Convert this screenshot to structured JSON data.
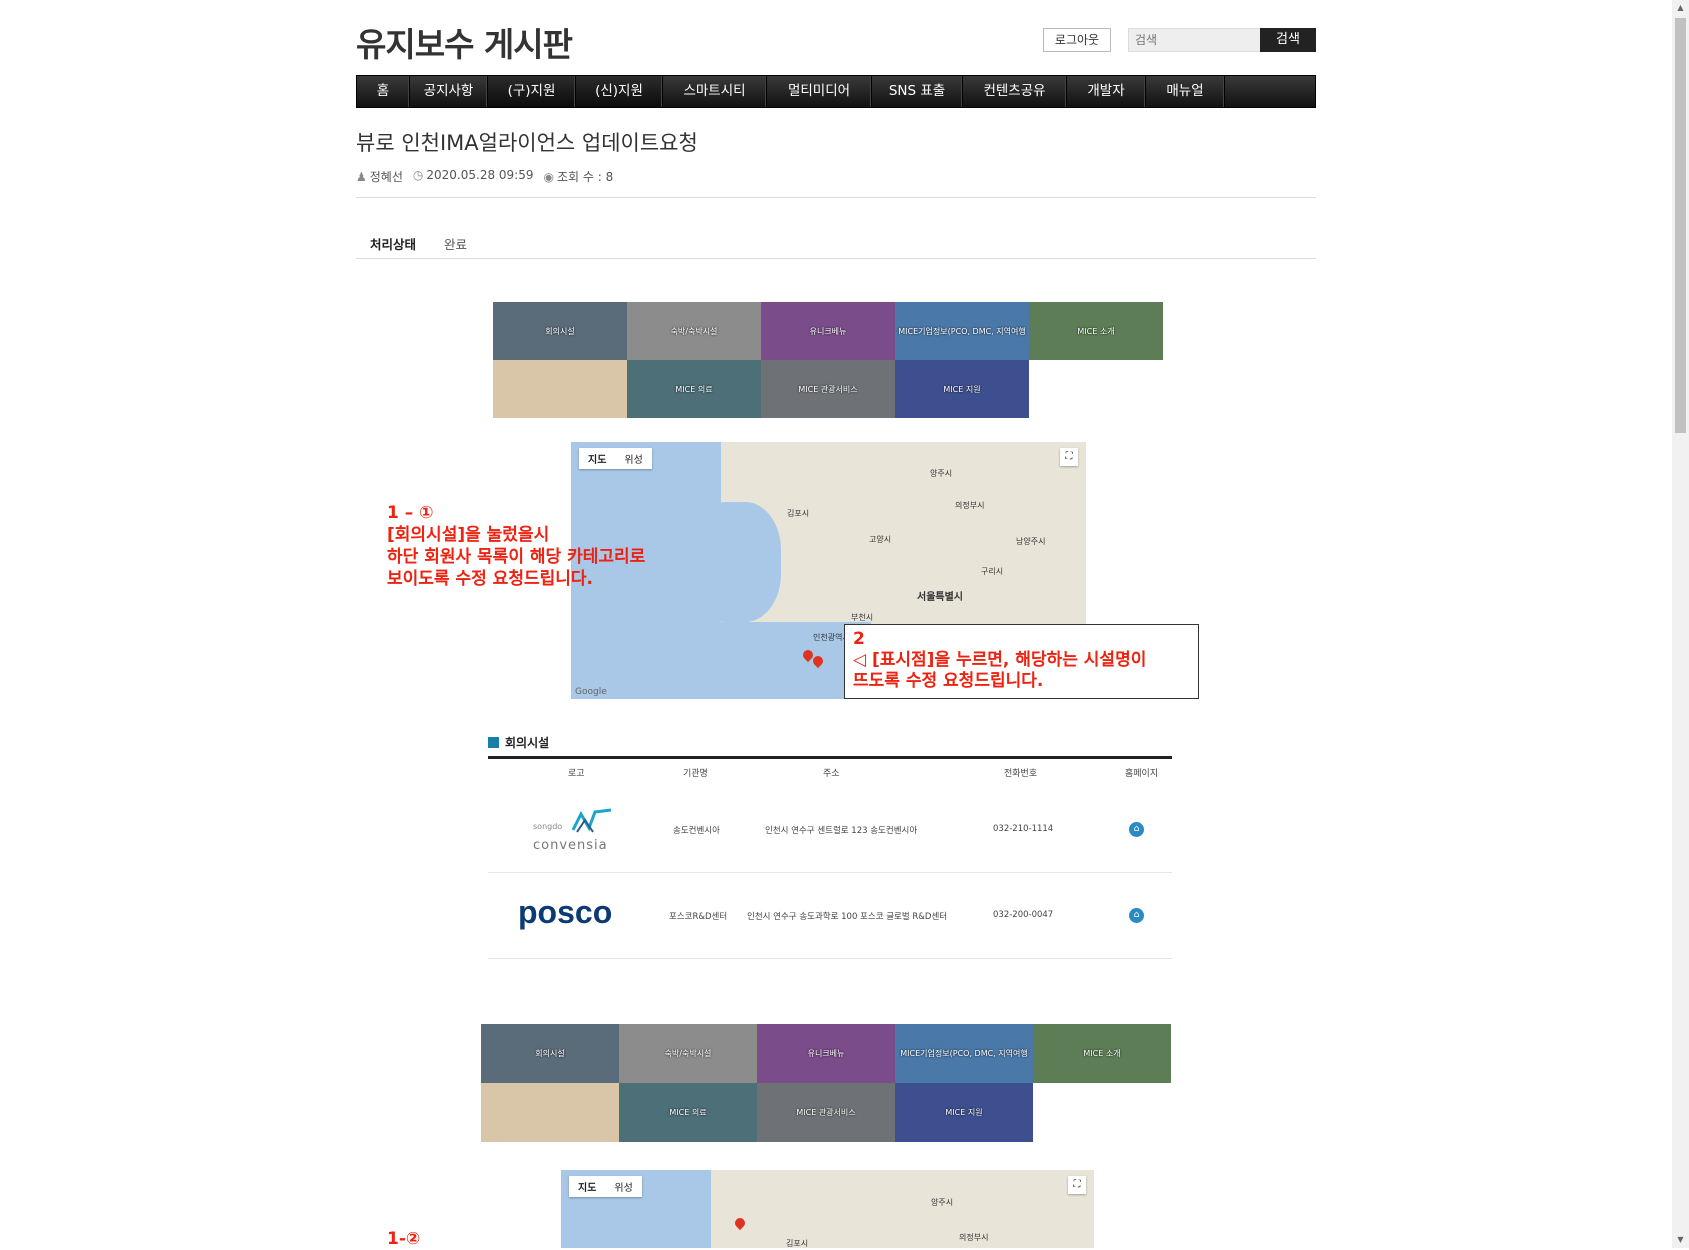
{
  "header": {
    "site_title": "유지보수 게시판",
    "logout_label": "로그아웃",
    "search_placeholder": "검색",
    "search_button": "검색"
  },
  "nav": [
    {
      "label": "홈",
      "w": 52
    },
    {
      "label": "공지사항",
      "w": 77
    },
    {
      "label": "(구)지원",
      "w": 87
    },
    {
      "label": "(신)지원",
      "w": 86
    },
    {
      "label": "스마트시티",
      "w": 103
    },
    {
      "label": "멀티미디어",
      "w": 104
    },
    {
      "label": "SNS 표출",
      "w": 90
    },
    {
      "label": "컨텐츠공유",
      "w": 103
    },
    {
      "label": "개발자",
      "w": 78
    },
    {
      "label": "매뉴얼",
      "w": 78
    }
  ],
  "post": {
    "title": "뷰로 인천IMA얼라이언스 업데이트요청",
    "author": "정혜선",
    "date": "2020.05.28 09:59",
    "views": "조회 수 : 8",
    "status_label": "처리상태",
    "status_value": "완료"
  },
  "banner_tiles": [
    {
      "label": "회의시설",
      "color": "#5a6b7a"
    },
    {
      "label": "숙박/숙박시설",
      "color": "#8c8c8c"
    },
    {
      "label": "유니크베뉴",
      "color": "#7a4d8a"
    },
    {
      "label": "MICE기업정보(PCO, DMC, 지역여행",
      "color": "#4a78a8"
    },
    {
      "label": "MICE 소개",
      "color": "#5d7d56"
    },
    {
      "label": "",
      "color": "#d9c6a8"
    },
    {
      "label": "MICE 의료",
      "color": "#4c6f78"
    },
    {
      "label": "MICE 관광서비스",
      "color": "#6e7276"
    },
    {
      "label": "MICE 지원",
      "color": "#3d4f8f"
    },
    {
      "label": "",
      "color": "#ffffff"
    }
  ],
  "map": {
    "tab_map": "지도",
    "tab_satellite": "위성",
    "fullscreen_icon": "fullscreen-icon",
    "google": "Google",
    "places": [
      {
        "name": "양주시",
        "big": false
      },
      {
        "name": "김포시",
        "big": false
      },
      {
        "name": "의정부시",
        "big": false
      },
      {
        "name": "고양시",
        "big": false
      },
      {
        "name": "남양주시",
        "big": false
      },
      {
        "name": "서울특별시",
        "big": true
      },
      {
        "name": "부천시",
        "big": false
      },
      {
        "name": "인천광역시",
        "big": false
      },
      {
        "name": "구리시",
        "big": false
      }
    ]
  },
  "notes": {
    "n1": [
      "1 – ①",
      "[회의시설]을 눌렀을시",
      "하단 회원사 목록이 해당 카테고리로",
      "보이도록 수정 요청드립니다."
    ],
    "n2": [
      "2",
      "◁ [표시점]을 누르면, 해당하는 시설명이",
      "뜨도록 수정 요청드립니다."
    ],
    "n3": "1-②"
  },
  "facility": {
    "heading": "회의시설",
    "columns": [
      "로고",
      "기관명",
      "주소",
      "전화번호",
      "홈페이지"
    ],
    "rows": [
      {
        "logo_top": "songdo",
        "logo_bottom": "convensia",
        "name": "송도컨벤시아",
        "address": "인천시 연수구 센트럴로 123 송도컨벤시아",
        "phone": "032-210-1114"
      },
      {
        "logo_text": "posco",
        "name": "포스코R&D센터",
        "address": "인천시 연수구 송도과학로 100 포스코 글로벌 R&D센터",
        "phone": "032-200-0047"
      }
    ]
  }
}
